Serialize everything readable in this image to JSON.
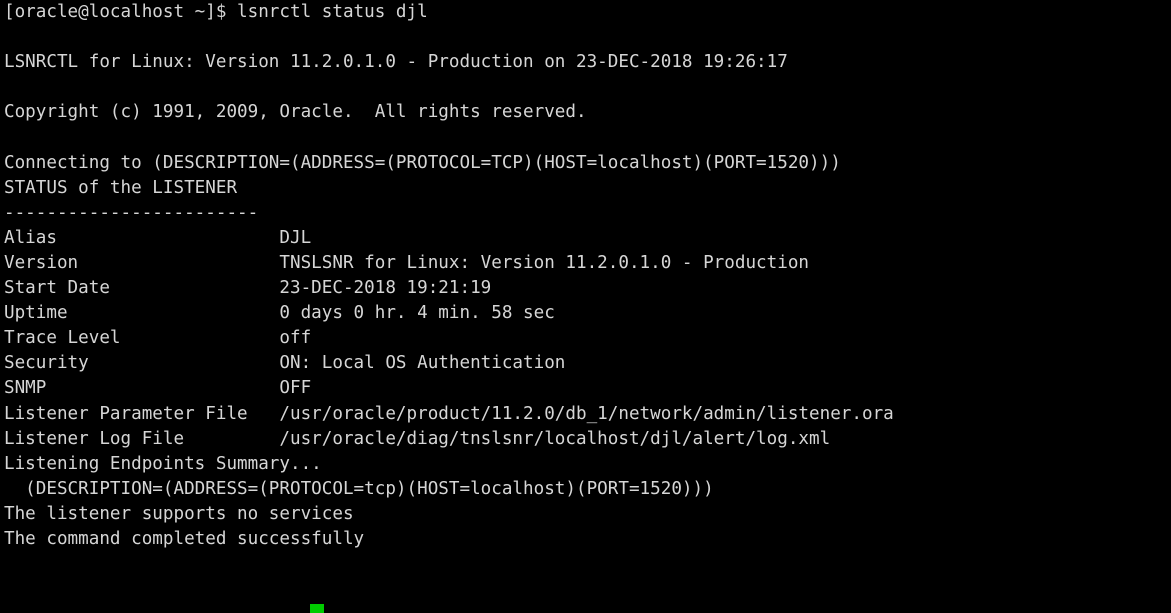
{
  "terminal": {
    "title": "Terminal",
    "colors": {
      "background": "#000000",
      "foreground": "#d6d6d6",
      "cursor": "#00cc00"
    },
    "prompt": "[oracle@localhost ~]$",
    "command": "lsnrctl status djl",
    "cursor": {
      "row": 24,
      "column": 22,
      "visible": true
    },
    "lines": [
      "[oracle@localhost ~]$ lsnrctl status djl",
      "",
      "LSNRCTL for Linux: Version 11.2.0.1.0 - Production on 23-DEC-2018 19:26:17",
      "",
      "Copyright (c) 1991, 2009, Oracle.  All rights reserved.",
      "",
      "Connecting to (DESCRIPTION=(ADDRESS=(PROTOCOL=TCP)(HOST=localhost)(PORT=1520)))",
      "STATUS of the LISTENER",
      "------------------------",
      "Alias                     DJL",
      "Version                   TNSLSNR for Linux: Version 11.2.0.1.0 - Production",
      "Start Date                23-DEC-2018 19:21:19",
      "Uptime                    0 days 0 hr. 4 min. 58 sec",
      "Trace Level               off",
      "Security                  ON: Local OS Authentication",
      "SNMP                      OFF",
      "Listener Parameter File   /usr/oracle/product/11.2.0/db_1/network/admin/listener.ora",
      "Listener Log File         /usr/oracle/diag/tnslsnr/localhost/djl/alert/log.xml",
      "Listening Endpoints Summary...",
      "  (DESCRIPTION=(ADDRESS=(PROTOCOL=tcp)(HOST=localhost)(PORT=1520)))",
      "The listener supports no services",
      "The command completed successfully",
      ""
    ],
    "status_fields": [
      {
        "label": "Alias",
        "value": "DJL"
      },
      {
        "label": "Version",
        "value": "TNSLSNR for Linux: Version 11.2.0.1.0 - Production"
      },
      {
        "label": "Start Date",
        "value": "23-DEC-2018 19:21:19"
      },
      {
        "label": "Uptime",
        "value": "0 days 0 hr. 4 min. 58 sec"
      },
      {
        "label": "Trace Level",
        "value": "off"
      },
      {
        "label": "Security",
        "value": "ON: Local OS Authentication"
      },
      {
        "label": "SNMP",
        "value": "OFF"
      },
      {
        "label": "Listener Parameter File",
        "value": "/usr/oracle/product/11.2.0/db_1/network/admin/listener.ora"
      },
      {
        "label": "Listener Log File",
        "value": "/usr/oracle/diag/tnslsnr/localhost/djl/alert/log.xml"
      }
    ]
  }
}
